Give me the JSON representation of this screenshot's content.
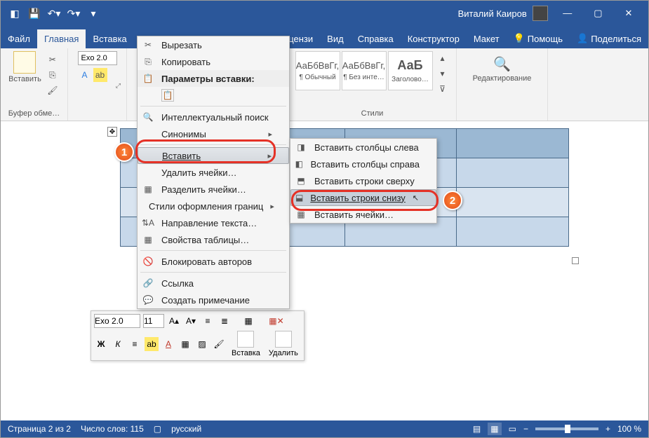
{
  "titlebar": {
    "user": "Виталий Каиров"
  },
  "tabs": {
    "file": "Файл",
    "home": "Главная",
    "insert": "Вставка",
    "review": "Рецензи",
    "view": "Вид",
    "help": "Справка",
    "design": "Конструктор",
    "layout": "Макет",
    "tellme": "Помощь",
    "share": "Поделиться"
  },
  "ribbon": {
    "paste": "Вставить",
    "clipboard_group": "Буфер обме…",
    "font_name": "Exo 2.0",
    "styles_group": "Стили",
    "style1": {
      "sample": "АаБбВвГг,",
      "name": "¶ Обычный"
    },
    "style2": {
      "sample": "АаБбВвГг,",
      "name": "¶ Без инте…"
    },
    "style3": {
      "sample": "АаБ",
      "name": "Заголово…"
    },
    "editing": "Редактирование"
  },
  "context_menu": {
    "cut": "Вырезать",
    "copy": "Копировать",
    "paste_options": "Параметры вставки:",
    "smart_lookup": "Интеллектуальный поиск",
    "synonyms": "Синонимы",
    "insert": "Вставить",
    "delete_cells": "Удалить ячейки…",
    "split_cells": "Разделить ячейки…",
    "border_styles": "Стили оформления границ",
    "text_direction": "Направление текста…",
    "table_properties": "Свойства таблицы…",
    "block_authors": "Блокировать авторов",
    "link": "Ссылка",
    "new_comment": "Создать примечание"
  },
  "submenu": {
    "cols_left": "Вставить столбцы слева",
    "cols_right": "Вставить столбцы справа",
    "rows_above": "Вставить строки сверху",
    "rows_below": "Вставить строки снизу",
    "cells": "Вставить ячейки…"
  },
  "mini_toolbar": {
    "font": "Exo 2.0",
    "size": "11",
    "insert": "Вставка",
    "delete": "Удалить"
  },
  "statusbar": {
    "page": "Страница 2 из 2",
    "words": "Число слов: 115",
    "lang": "русский",
    "zoom": "100 %"
  }
}
